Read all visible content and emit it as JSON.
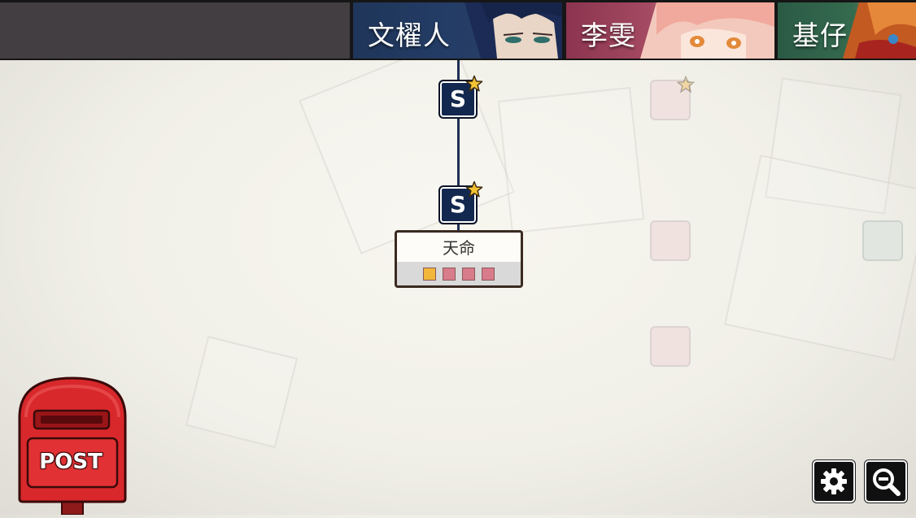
{
  "characters": [
    {
      "name": "文櫂人",
      "accent": "#243d66"
    },
    {
      "name": "李雯",
      "accent": "#a44a62"
    },
    {
      "name": "基仔",
      "accent": "#356b4f"
    }
  ],
  "route": {
    "nodes": [
      {
        "label": "S",
        "starred": true
      },
      {
        "label": "S",
        "starred": true
      }
    ],
    "destiny": {
      "title": "天命",
      "markers": [
        "#f2b63a",
        "#d87b8a",
        "#d87b8a",
        "#d87b8a"
      ]
    }
  },
  "postbox": {
    "label": "POST"
  },
  "buttons": [
    {
      "name": "settings",
      "icon": "gear-icon"
    },
    {
      "name": "zoom-out",
      "icon": "zoom-out-icon"
    }
  ]
}
